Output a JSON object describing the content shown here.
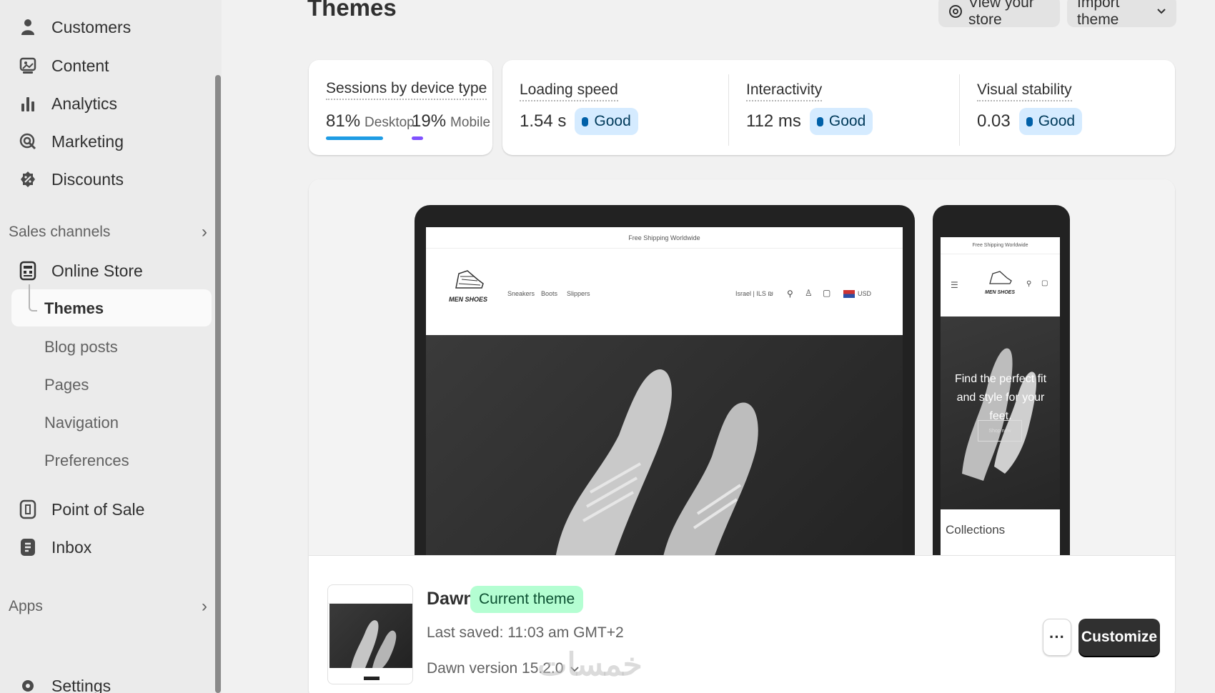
{
  "sidebar": {
    "items": [
      {
        "label": "Customers",
        "icon": "person-icon"
      },
      {
        "label": "Content",
        "icon": "content-icon"
      },
      {
        "label": "Analytics",
        "icon": "bar-chart-icon"
      },
      {
        "label": "Marketing",
        "icon": "target-icon"
      },
      {
        "label": "Discounts",
        "icon": "discount-icon"
      }
    ],
    "sales_channels_label": "Sales channels",
    "online_store_label": "Online Store",
    "sub_items": [
      "Themes",
      "Blog posts",
      "Pages",
      "Navigation",
      "Preferences"
    ],
    "point_of_sale_label": "Point of Sale",
    "inbox_label": "Inbox",
    "apps_label": "Apps",
    "settings_label": "Settings"
  },
  "header": {
    "title": "Themes",
    "view_store_label": "View your store",
    "import_theme_label": "Import theme"
  },
  "sessions": {
    "label": "Sessions by device type",
    "desktop_pct": "81%",
    "desktop_label": "Desktop",
    "mobile_pct": "19%",
    "mobile_label": "Mobile",
    "desktop_color": "#1f9ce4",
    "mobile_color": "#8051ff"
  },
  "metrics": [
    {
      "label": "Loading speed",
      "value": "1.54 s",
      "status": "Good"
    },
    {
      "label": "Interactivity",
      "value": "112 ms",
      "status": "Good"
    },
    {
      "label": "Visual stability",
      "value": "0.03",
      "status": "Good"
    }
  ],
  "preview": {
    "announcement": "Free Shipping Worldwide",
    "logo": "MEN SHOES",
    "nav": [
      "Sneakers",
      "Boots",
      "Slippers"
    ],
    "locale": "Israel | ILS ₪",
    "currency": "USD",
    "mobile_hero_text": "Find the perfect fit and style for your feet.",
    "mobile_button": "Shop now",
    "collections_label": "Collections"
  },
  "theme": {
    "name": "Dawn",
    "badge": "Current theme",
    "last_saved": "Last saved: 11:03 am GMT+2",
    "version": "Dawn version 15.2.0",
    "more_label": "···",
    "customize_label": "Customize"
  },
  "watermark": "خمسات",
  "colors": {
    "sidebar_bg": "#ebebeb",
    "page_bg": "#f1f1f1",
    "good_badge_bg": "#d5ebff",
    "current_badge_bg": "#b4fed2",
    "primary_button": "#303030"
  }
}
